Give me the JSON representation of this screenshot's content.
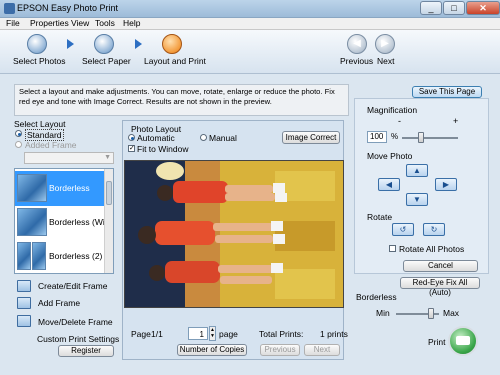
{
  "window": {
    "title": "EPSON Easy Photo Print",
    "buttons": [
      "minimize",
      "maximize",
      "close"
    ]
  },
  "menu": [
    "File",
    "Properties",
    "View",
    "Tools",
    "Help"
  ],
  "steps": [
    {
      "label": "Select Photos",
      "icon": "photos-step-icon"
    },
    {
      "label": "Select Paper",
      "icon": "paper-step-icon"
    },
    {
      "label": "Layout and Print",
      "icon": "layout-step-icon",
      "active": true
    }
  ],
  "nav": {
    "previous": "Previous",
    "next": "Next"
  },
  "instructions": "Select a layout and make adjustments. You can move, rotate, enlarge or reduce the photo. Fix red eye and tone with Image Correct. Results are not shown in the preview.",
  "save_page": "Save This Page",
  "select_layout": {
    "label": "Select Layout",
    "standard": "Standard",
    "added_frame": "Added Frame",
    "items": [
      "Borderless",
      "Borderless (With",
      "Borderless (2)"
    ]
  },
  "frame_actions": {
    "create_edit": "Create/Edit Frame",
    "add": "Add Frame",
    "move_delete": "Move/Delete Frame",
    "custom_settings": "Custom Print Settings",
    "register": "Register"
  },
  "photo_layout": {
    "label": "Photo Layout",
    "automatic": "Automatic",
    "manual": "Manual",
    "fit_to_window": "Fit to Window",
    "image_correct": "Image Correct"
  },
  "pagination": {
    "page_label": "Page",
    "page_value": "1/1",
    "spinner_value": "1",
    "page_suffix": "page",
    "total_label": "Total Prints:",
    "total_value": "1 prints",
    "copies": "Number of Copies",
    "previous": "Previous",
    "next": "Next"
  },
  "magnification": {
    "label": "Magnification",
    "minus": "-",
    "plus": "+",
    "value": "100",
    "unit": "%"
  },
  "move_photo": {
    "label": "Move Photo"
  },
  "rotate": {
    "label": "Rotate",
    "rotate_all": "Rotate All Photos"
  },
  "cancel": "Cancel",
  "red_eye": "Red-Eye Fix All (Auto)",
  "borderless": {
    "label": "Borderless",
    "min": "Min",
    "max": "Max"
  },
  "print": {
    "label": "Print"
  },
  "colors": {
    "accent": "#3399ff",
    "toolbar": "#d7e3ef",
    "print_green": "#3aa64a"
  }
}
